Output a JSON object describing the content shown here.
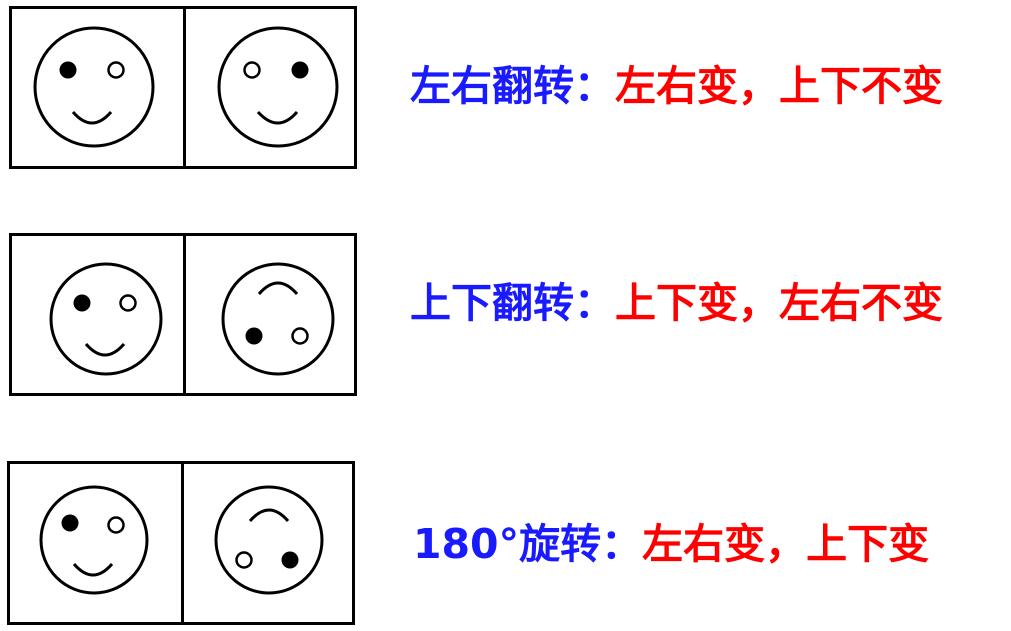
{
  "colors": {
    "label": "#1a1aff",
    "effect": "#ff0000",
    "stroke": "#000000"
  },
  "rows": [
    {
      "label": "左右翻转",
      "colon": "：",
      "effect": "左右变，上下不变",
      "left_face": "smile-filled-left-eye-icon",
      "right_face": "smile-filled-right-eye-icon"
    },
    {
      "label": "上下翻转",
      "colon": "：",
      "effect": "上下变，左右不变",
      "left_face": "smile-filled-left-eye-icon",
      "right_face": "upside-down-filled-left-eye-icon"
    },
    {
      "label": "180°旋转",
      "colon": "：",
      "effect": "左右变，上下变",
      "left_face": "smile-filled-left-eye-icon",
      "right_face": "upside-down-filled-right-eye-icon"
    }
  ]
}
